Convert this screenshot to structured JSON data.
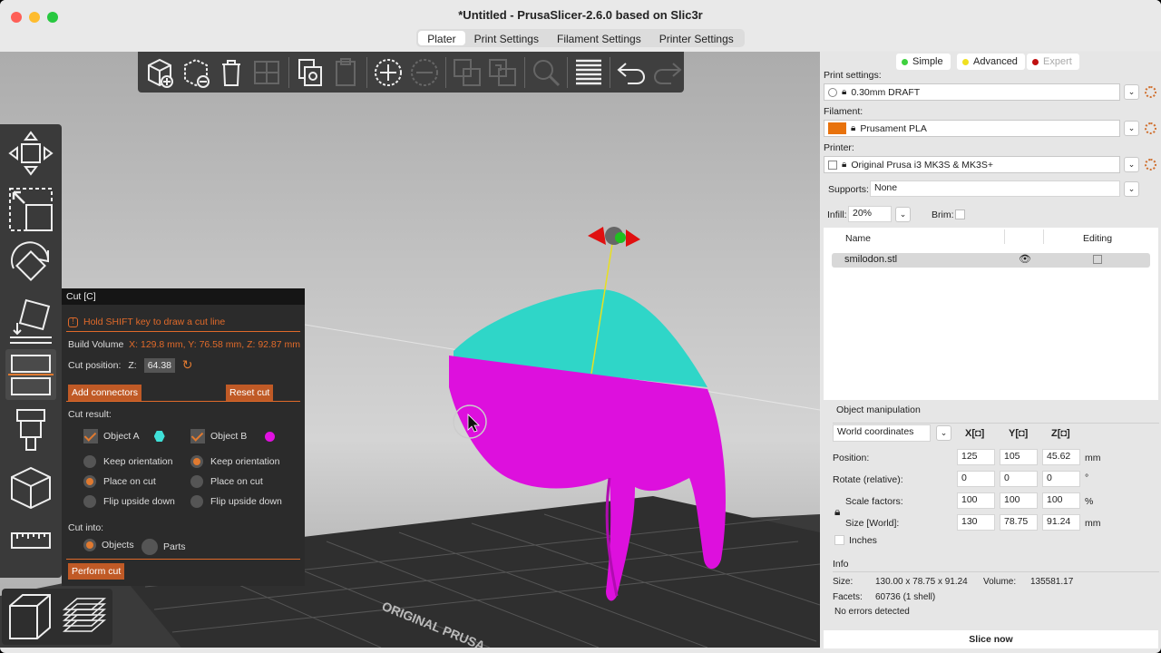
{
  "window": {
    "title": "*Untitled - PrusaSlicer-2.6.0 based on Slic3r"
  },
  "tabs": [
    {
      "label": "Plater"
    },
    {
      "label": "Print Settings"
    },
    {
      "label": "Filament Settings"
    },
    {
      "label": "Printer Settings"
    }
  ],
  "viewport": {
    "bed_label": "ORIGINAL PRUSA"
  },
  "cut": {
    "title": "Cut [C]",
    "hint": "Hold SHIFT key to draw a cut line",
    "build_volume_label": "Build Volume",
    "build_volume_value": "X: 129.8 mm,  Y: 76.58 mm,  Z: 92.87 mm",
    "cut_position_label": "Cut position:",
    "z_label": "Z:",
    "z_value": "64.38",
    "add_connectors": "Add connectors",
    "reset_cut": "Reset cut",
    "cut_result_label": "Cut result:",
    "object_a": "Object A",
    "object_b": "Object B",
    "keep_orientation_a": "Keep orientation",
    "keep_orientation_b": "Keep orientation",
    "place_on_cut_a": "Place on cut",
    "place_on_cut_b": "Place on cut",
    "flip_a": "Flip upside down",
    "flip_b": "Flip upside down",
    "cut_into_label": "Cut into:",
    "objects": "Objects",
    "parts": "Parts",
    "perform_cut": "Perform cut",
    "color_a": "#3fe0d8",
    "color_b": "#e010e0"
  },
  "modes": {
    "simple": "Simple",
    "advanced": "Advanced",
    "expert": "Expert"
  },
  "settings": {
    "print_label": "Print settings:",
    "print_value": "0.30mm DRAFT",
    "filament_label": "Filament:",
    "filament_value": "Prusament PLA",
    "filament_color": "#e8720c",
    "printer_label": "Printer:",
    "printer_value": "Original Prusa i3 MK3S & MK3S+",
    "supports_label": "Supports:",
    "supports_value": "None",
    "infill_label": "Infill:",
    "infill_value": "20%",
    "brim_label": "Brim:"
  },
  "object_list": {
    "col_name": "Name",
    "col_editing": "Editing",
    "items": [
      {
        "name": "smilodon.stl"
      }
    ]
  },
  "manip": {
    "title": "Object manipulation",
    "coord_system": "World coordinates",
    "x": "X",
    "y": "Y",
    "z": "Z",
    "position_label": "Position:",
    "position": [
      "125",
      "105",
      "45.62"
    ],
    "position_unit": "mm",
    "rotate_label": "Rotate (relative):",
    "rotate": [
      "0",
      "0",
      "0"
    ],
    "rotate_unit": "°",
    "scale_label": "Scale factors:",
    "scale": [
      "100",
      "100",
      "100"
    ],
    "scale_unit": "%",
    "size_label": "Size [World]:",
    "size": [
      "130",
      "78.75",
      "91.24"
    ],
    "size_unit": "mm",
    "inches_label": "Inches"
  },
  "info": {
    "title": "Info",
    "size_label": "Size:",
    "size_value": "130.00 x 78.75 x 91.24",
    "volume_label": "Volume:",
    "volume_value": "135581.17",
    "facets_label": "Facets:",
    "facets_value": "60736 (1 shell)",
    "errors": "No errors detected"
  },
  "slice_now": "Slice now"
}
